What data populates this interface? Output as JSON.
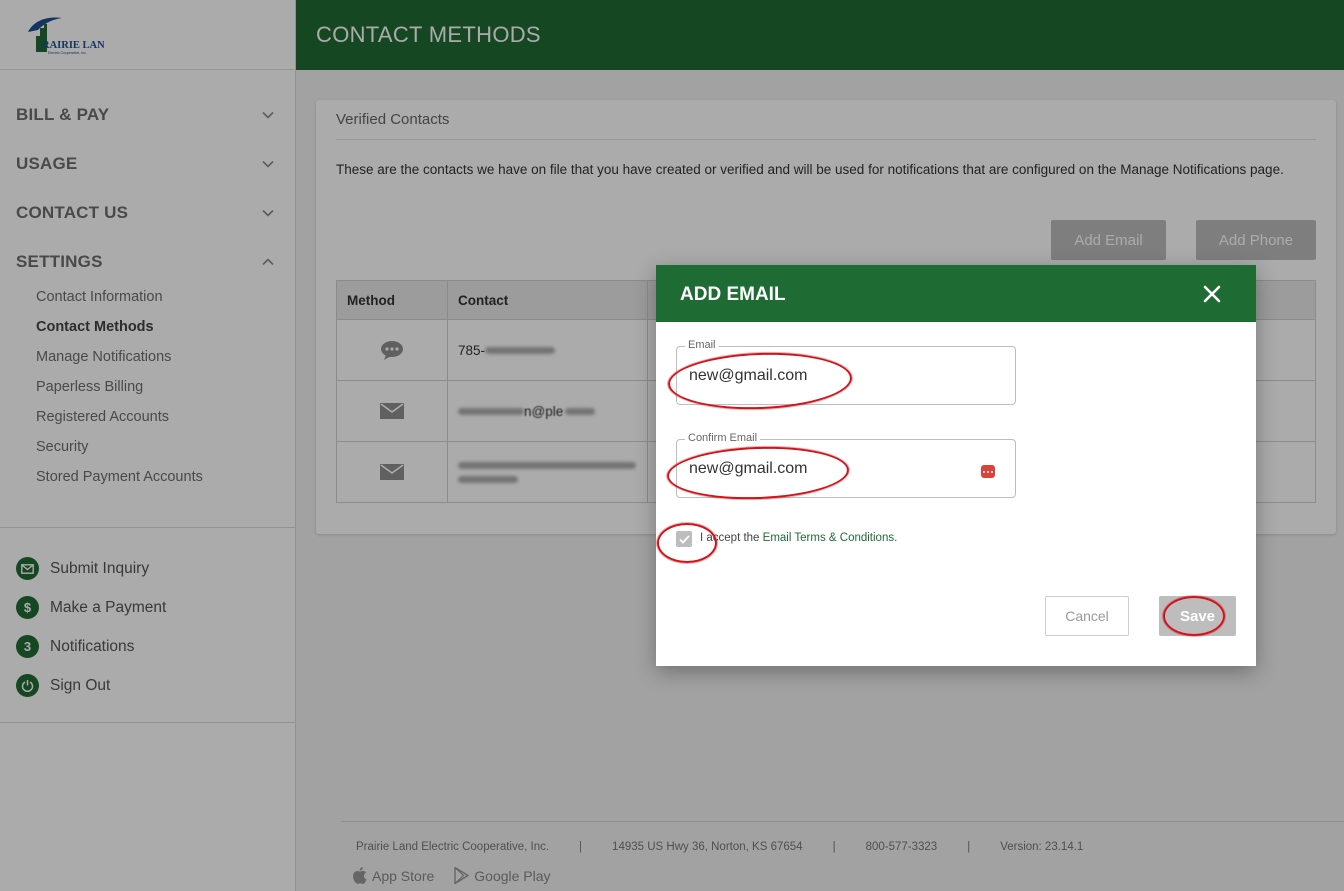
{
  "brand": {
    "logo_text": "PRAIRIE LAND",
    "logo_sub": "Electric Cooperative, Inc.",
    "accent": "#1f6b34"
  },
  "header": {
    "title": "CONTACT METHODS"
  },
  "sidebar": {
    "sections": [
      {
        "label": "BILL & PAY",
        "expanded": false
      },
      {
        "label": "USAGE",
        "expanded": false
      },
      {
        "label": "CONTACT US",
        "expanded": false
      },
      {
        "label": "SETTINGS",
        "expanded": true
      }
    ],
    "settings_items": [
      {
        "label": "Contact Information",
        "active": false
      },
      {
        "label": "Contact Methods",
        "active": true
      },
      {
        "label": "Manage Notifications",
        "active": false
      },
      {
        "label": "Paperless Billing",
        "active": false
      },
      {
        "label": "Registered Accounts",
        "active": false
      },
      {
        "label": "Security",
        "active": false
      },
      {
        "label": "Stored Payment Accounts",
        "active": false
      }
    ],
    "quick_links": [
      {
        "label": "Submit Inquiry",
        "icon": "envelope-icon"
      },
      {
        "label": "Make a Payment",
        "icon": "dollar-icon"
      },
      {
        "label": "Notifications",
        "icon": "badge",
        "badge": "3"
      },
      {
        "label": "Sign Out",
        "icon": "power-icon"
      }
    ]
  },
  "card": {
    "title": "Verified Contacts",
    "description": "These are the contacts we have on file that you have created or verified and will be used for notifications that are configured on the Manage Notifications page.",
    "add_email_label": "Add Email",
    "add_phone_label": "Add Phone",
    "columns": [
      "Method",
      "Contact"
    ],
    "rows": [
      {
        "method_icon": "chat-icon",
        "contact_prefix": "785-"
      },
      {
        "method_icon": "envelope-icon",
        "contact_visible": "n@ple"
      },
      {
        "method_icon": "envelope-icon",
        "contact_visible": ""
      }
    ]
  },
  "modal": {
    "title": "ADD EMAIL",
    "email_label": "Email",
    "email_value": "new@gmail.com",
    "confirm_label": "Confirm Email",
    "confirm_value": "new@gmail.com",
    "terms_prefix": "I accept the ",
    "terms_link": "Email Terms & Conditions.",
    "accepted": true,
    "cancel_label": "Cancel",
    "save_label": "Save"
  },
  "footer": {
    "company": "Prairie Land Electric Cooperative, Inc.",
    "address": "14935 US Hwy 36, Norton, KS 67654",
    "phone": "800-577-3323",
    "version": "Version: 23.14.1",
    "separator": "|",
    "app_store": "App Store",
    "google_play": "Google Play"
  },
  "annotation_color": "#d0141b"
}
